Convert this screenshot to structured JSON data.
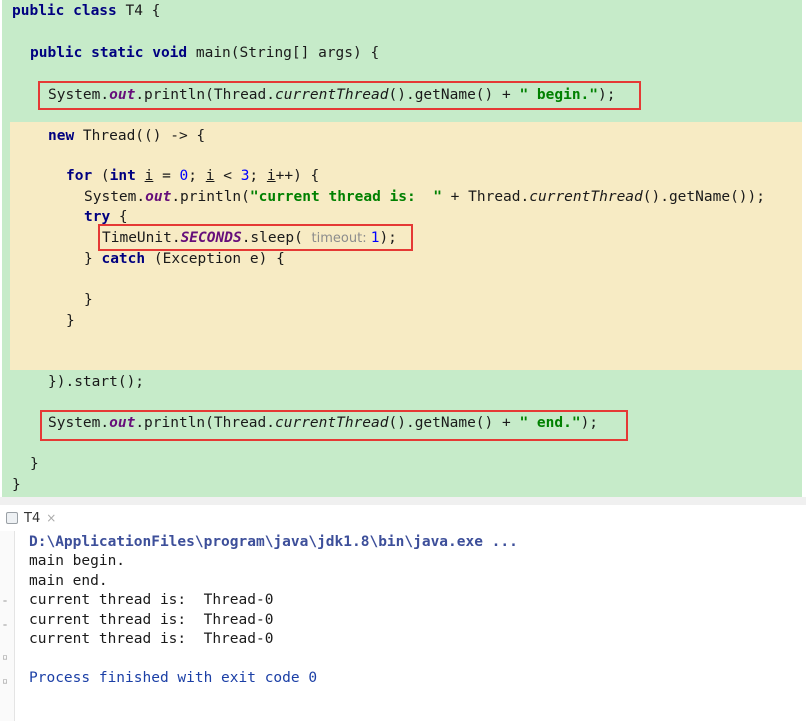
{
  "editor": {
    "lines": {
      "l1": [
        "public class",
        " T4 {"
      ],
      "l2": [
        "public static void",
        " main(String[] args) {"
      ],
      "l3": [
        "System.",
        "out",
        ".println(Thread.",
        "currentThread",
        "().getName() + ",
        "\" begin.\"",
        ");"
      ],
      "l4": [
        "new",
        " Thread(() -> {"
      ],
      "l5": [
        "for",
        " (",
        "int",
        " ",
        "i",
        " = ",
        "0",
        "; ",
        "i",
        " < ",
        "3",
        "; ",
        "i",
        "++) {"
      ],
      "l6": [
        "System.",
        "out",
        ".println(",
        "\"current thread is:  \"",
        " + Thread.",
        "currentThread",
        "().getName());"
      ],
      "l7": [
        "try",
        " {"
      ],
      "l8": [
        "TimeUnit.",
        "SECONDS",
        ".sleep( ",
        "timeout:",
        " ",
        "1",
        ");"
      ],
      "l9": [
        "} ",
        "catch",
        " (Exception e) {"
      ],
      "l10": "}",
      "l11": "}",
      "l12": "}).start();",
      "l13": [
        "System.",
        "out",
        ".println(Thread.",
        "currentThread",
        "().getName() + ",
        "\" end.\"",
        ");"
      ],
      "l14": "}",
      "l15": "}"
    }
  },
  "run_panel": {
    "tab_label": "T4",
    "close_glyph": "×",
    "output": [
      "D:\\ApplicationFiles\\program\\java\\jdk1.8\\bin\\java.exe ...",
      "main begin.",
      "main end.",
      "current thread is:  Thread-0",
      "current thread is:  Thread-0",
      "current thread is:  Thread-0",
      "",
      "Process finished with exit code 0"
    ]
  },
  "colors": {
    "green_bg": "#c6ebc9",
    "yellow_bg": "#f7ebc4",
    "highlight_box": "#e53935",
    "keyword": "#000080",
    "string": "#008000",
    "field": "#660e7a"
  }
}
